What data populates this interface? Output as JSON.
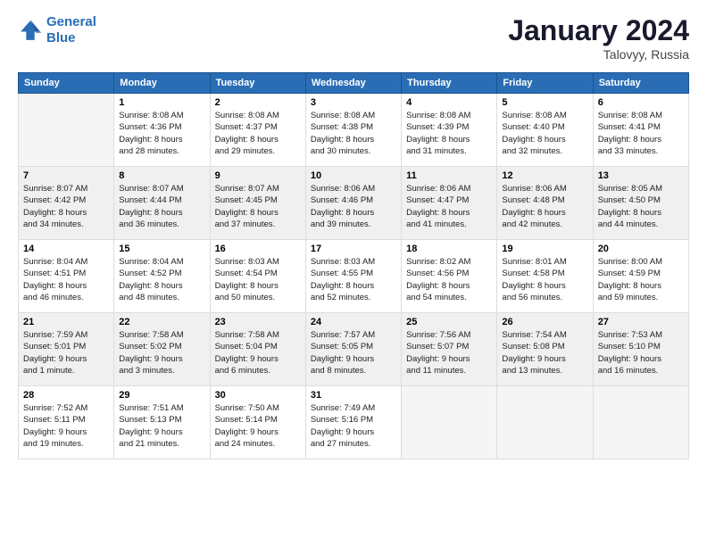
{
  "logo": {
    "line1": "General",
    "line2": "Blue"
  },
  "title": "January 2024",
  "subtitle": "Talovyy, Russia",
  "days_header": [
    "Sunday",
    "Monday",
    "Tuesday",
    "Wednesday",
    "Thursday",
    "Friday",
    "Saturday"
  ],
  "weeks": [
    [
      {
        "num": "",
        "info": ""
      },
      {
        "num": "1",
        "info": "Sunrise: 8:08 AM\nSunset: 4:36 PM\nDaylight: 8 hours\nand 28 minutes."
      },
      {
        "num": "2",
        "info": "Sunrise: 8:08 AM\nSunset: 4:37 PM\nDaylight: 8 hours\nand 29 minutes."
      },
      {
        "num": "3",
        "info": "Sunrise: 8:08 AM\nSunset: 4:38 PM\nDaylight: 8 hours\nand 30 minutes."
      },
      {
        "num": "4",
        "info": "Sunrise: 8:08 AM\nSunset: 4:39 PM\nDaylight: 8 hours\nand 31 minutes."
      },
      {
        "num": "5",
        "info": "Sunrise: 8:08 AM\nSunset: 4:40 PM\nDaylight: 8 hours\nand 32 minutes."
      },
      {
        "num": "6",
        "info": "Sunrise: 8:08 AM\nSunset: 4:41 PM\nDaylight: 8 hours\nand 33 minutes."
      }
    ],
    [
      {
        "num": "7",
        "info": "Sunrise: 8:07 AM\nSunset: 4:42 PM\nDaylight: 8 hours\nand 34 minutes."
      },
      {
        "num": "8",
        "info": "Sunrise: 8:07 AM\nSunset: 4:44 PM\nDaylight: 8 hours\nand 36 minutes."
      },
      {
        "num": "9",
        "info": "Sunrise: 8:07 AM\nSunset: 4:45 PM\nDaylight: 8 hours\nand 37 minutes."
      },
      {
        "num": "10",
        "info": "Sunrise: 8:06 AM\nSunset: 4:46 PM\nDaylight: 8 hours\nand 39 minutes."
      },
      {
        "num": "11",
        "info": "Sunrise: 8:06 AM\nSunset: 4:47 PM\nDaylight: 8 hours\nand 41 minutes."
      },
      {
        "num": "12",
        "info": "Sunrise: 8:06 AM\nSunset: 4:48 PM\nDaylight: 8 hours\nand 42 minutes."
      },
      {
        "num": "13",
        "info": "Sunrise: 8:05 AM\nSunset: 4:50 PM\nDaylight: 8 hours\nand 44 minutes."
      }
    ],
    [
      {
        "num": "14",
        "info": "Sunrise: 8:04 AM\nSunset: 4:51 PM\nDaylight: 8 hours\nand 46 minutes."
      },
      {
        "num": "15",
        "info": "Sunrise: 8:04 AM\nSunset: 4:52 PM\nDaylight: 8 hours\nand 48 minutes."
      },
      {
        "num": "16",
        "info": "Sunrise: 8:03 AM\nSunset: 4:54 PM\nDaylight: 8 hours\nand 50 minutes."
      },
      {
        "num": "17",
        "info": "Sunrise: 8:03 AM\nSunset: 4:55 PM\nDaylight: 8 hours\nand 52 minutes."
      },
      {
        "num": "18",
        "info": "Sunrise: 8:02 AM\nSunset: 4:56 PM\nDaylight: 8 hours\nand 54 minutes."
      },
      {
        "num": "19",
        "info": "Sunrise: 8:01 AM\nSunset: 4:58 PM\nDaylight: 8 hours\nand 56 minutes."
      },
      {
        "num": "20",
        "info": "Sunrise: 8:00 AM\nSunset: 4:59 PM\nDaylight: 8 hours\nand 59 minutes."
      }
    ],
    [
      {
        "num": "21",
        "info": "Sunrise: 7:59 AM\nSunset: 5:01 PM\nDaylight: 9 hours\nand 1 minute."
      },
      {
        "num": "22",
        "info": "Sunrise: 7:58 AM\nSunset: 5:02 PM\nDaylight: 9 hours\nand 3 minutes."
      },
      {
        "num": "23",
        "info": "Sunrise: 7:58 AM\nSunset: 5:04 PM\nDaylight: 9 hours\nand 6 minutes."
      },
      {
        "num": "24",
        "info": "Sunrise: 7:57 AM\nSunset: 5:05 PM\nDaylight: 9 hours\nand 8 minutes."
      },
      {
        "num": "25",
        "info": "Sunrise: 7:56 AM\nSunset: 5:07 PM\nDaylight: 9 hours\nand 11 minutes."
      },
      {
        "num": "26",
        "info": "Sunrise: 7:54 AM\nSunset: 5:08 PM\nDaylight: 9 hours\nand 13 minutes."
      },
      {
        "num": "27",
        "info": "Sunrise: 7:53 AM\nSunset: 5:10 PM\nDaylight: 9 hours\nand 16 minutes."
      }
    ],
    [
      {
        "num": "28",
        "info": "Sunrise: 7:52 AM\nSunset: 5:11 PM\nDaylight: 9 hours\nand 19 minutes."
      },
      {
        "num": "29",
        "info": "Sunrise: 7:51 AM\nSunset: 5:13 PM\nDaylight: 9 hours\nand 21 minutes."
      },
      {
        "num": "30",
        "info": "Sunrise: 7:50 AM\nSunset: 5:14 PM\nDaylight: 9 hours\nand 24 minutes."
      },
      {
        "num": "31",
        "info": "Sunrise: 7:49 AM\nSunset: 5:16 PM\nDaylight: 9 hours\nand 27 minutes."
      },
      {
        "num": "",
        "info": ""
      },
      {
        "num": "",
        "info": ""
      },
      {
        "num": "",
        "info": ""
      }
    ]
  ]
}
